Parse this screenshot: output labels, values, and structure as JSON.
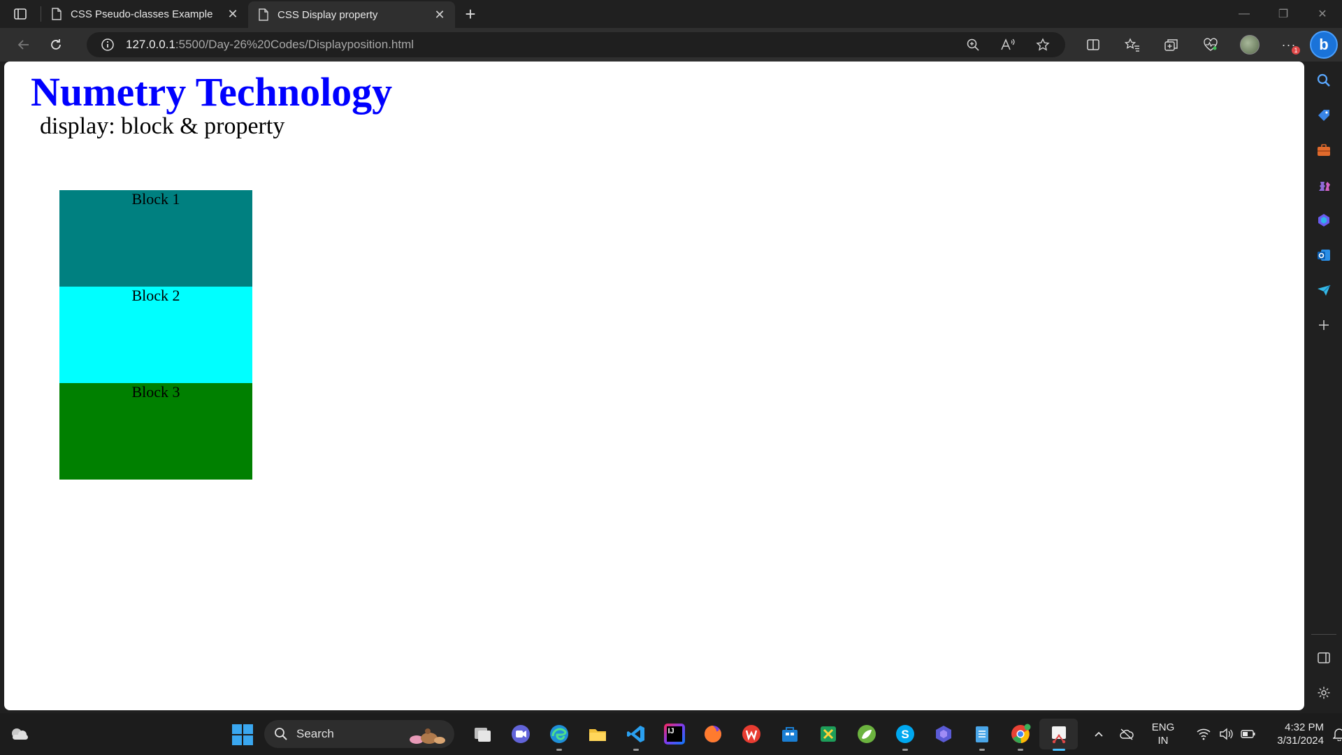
{
  "browser": {
    "tabs": [
      {
        "title": "CSS Pseudo-classes Example",
        "active": false
      },
      {
        "title": "CSS Display property",
        "active": true
      }
    ],
    "address": {
      "host": "127.0.0.1",
      "path": ":5500/Day-26%20Codes/Displayposition.html"
    },
    "notification_count": "1"
  },
  "page": {
    "heading": "Numetry Technology",
    "subheading": "display: block & property",
    "heading_color": "#0000ff",
    "blocks": [
      {
        "label": "Block 1",
        "color": "#008080"
      },
      {
        "label": "Block 2",
        "color": "#00ffff"
      },
      {
        "label": "Block 3",
        "color": "#008000"
      }
    ]
  },
  "sidebar": {
    "copilot_letter": "b",
    "items": [
      "search-icon",
      "tag-icon",
      "briefcase-icon",
      "chess-icon",
      "copilot-icon",
      "outlook-icon",
      "send-icon",
      "add-icon"
    ],
    "bottom": [
      "split-view-icon",
      "settings-icon"
    ]
  },
  "taskbar": {
    "search_label": "Search",
    "apps": [
      "task-view",
      "teams",
      "edge",
      "file-explorer",
      "vscode",
      "intellij",
      "firefox",
      "wps",
      "store",
      "excel-tool",
      "spring",
      "skype",
      "copilot",
      "notepad",
      "chrome",
      "snipping-tool"
    ],
    "language_line1": "ENG",
    "language_line2": "IN",
    "time": "4:32 PM",
    "date": "3/31/2024"
  }
}
